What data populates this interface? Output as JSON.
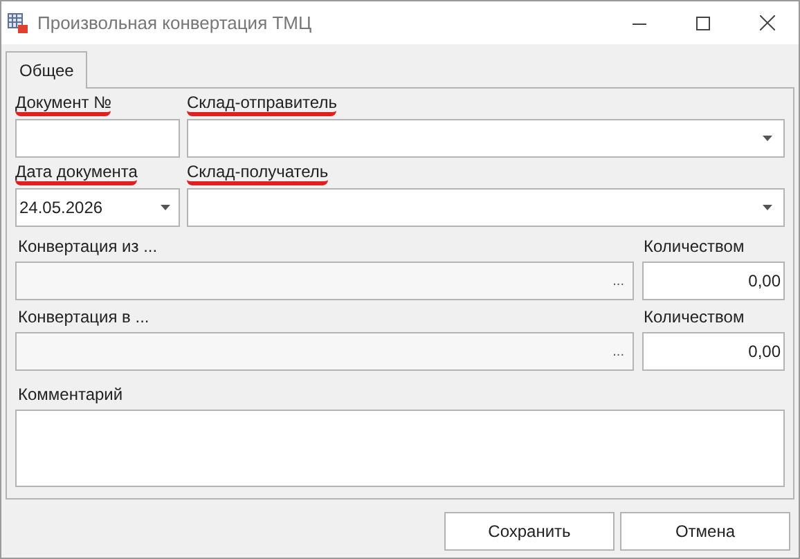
{
  "window": {
    "title": "Произвольная конвертация ТМЦ"
  },
  "tabs": [
    {
      "label": "Общее",
      "selected": true
    }
  ],
  "top_rows": [
    [
      {
        "kind": "text",
        "label": "Документ №",
        "required": true
      },
      {
        "kind": "combo",
        "label": "Склад-отправитель",
        "required": true
      }
    ],
    [
      {
        "kind": "date",
        "label": "Дата документа",
        "required": true,
        "value": "24.05.2026"
      },
      {
        "kind": "combo",
        "label": "Склад-получатель",
        "required": true
      }
    ]
  ],
  "conversions": [
    {
      "label": "Конвертация из ...",
      "ellipsis": "...",
      "quantity_label": "Количеством",
      "quantity": "0,00"
    },
    {
      "label": "Конвертация в ...",
      "ellipsis": "...",
      "quantity_label": "Количеством",
      "quantity": "0,00"
    }
  ],
  "comment": {
    "label": "Комментарий"
  },
  "buttons": [
    "Сохранить",
    "Отмена"
  ]
}
